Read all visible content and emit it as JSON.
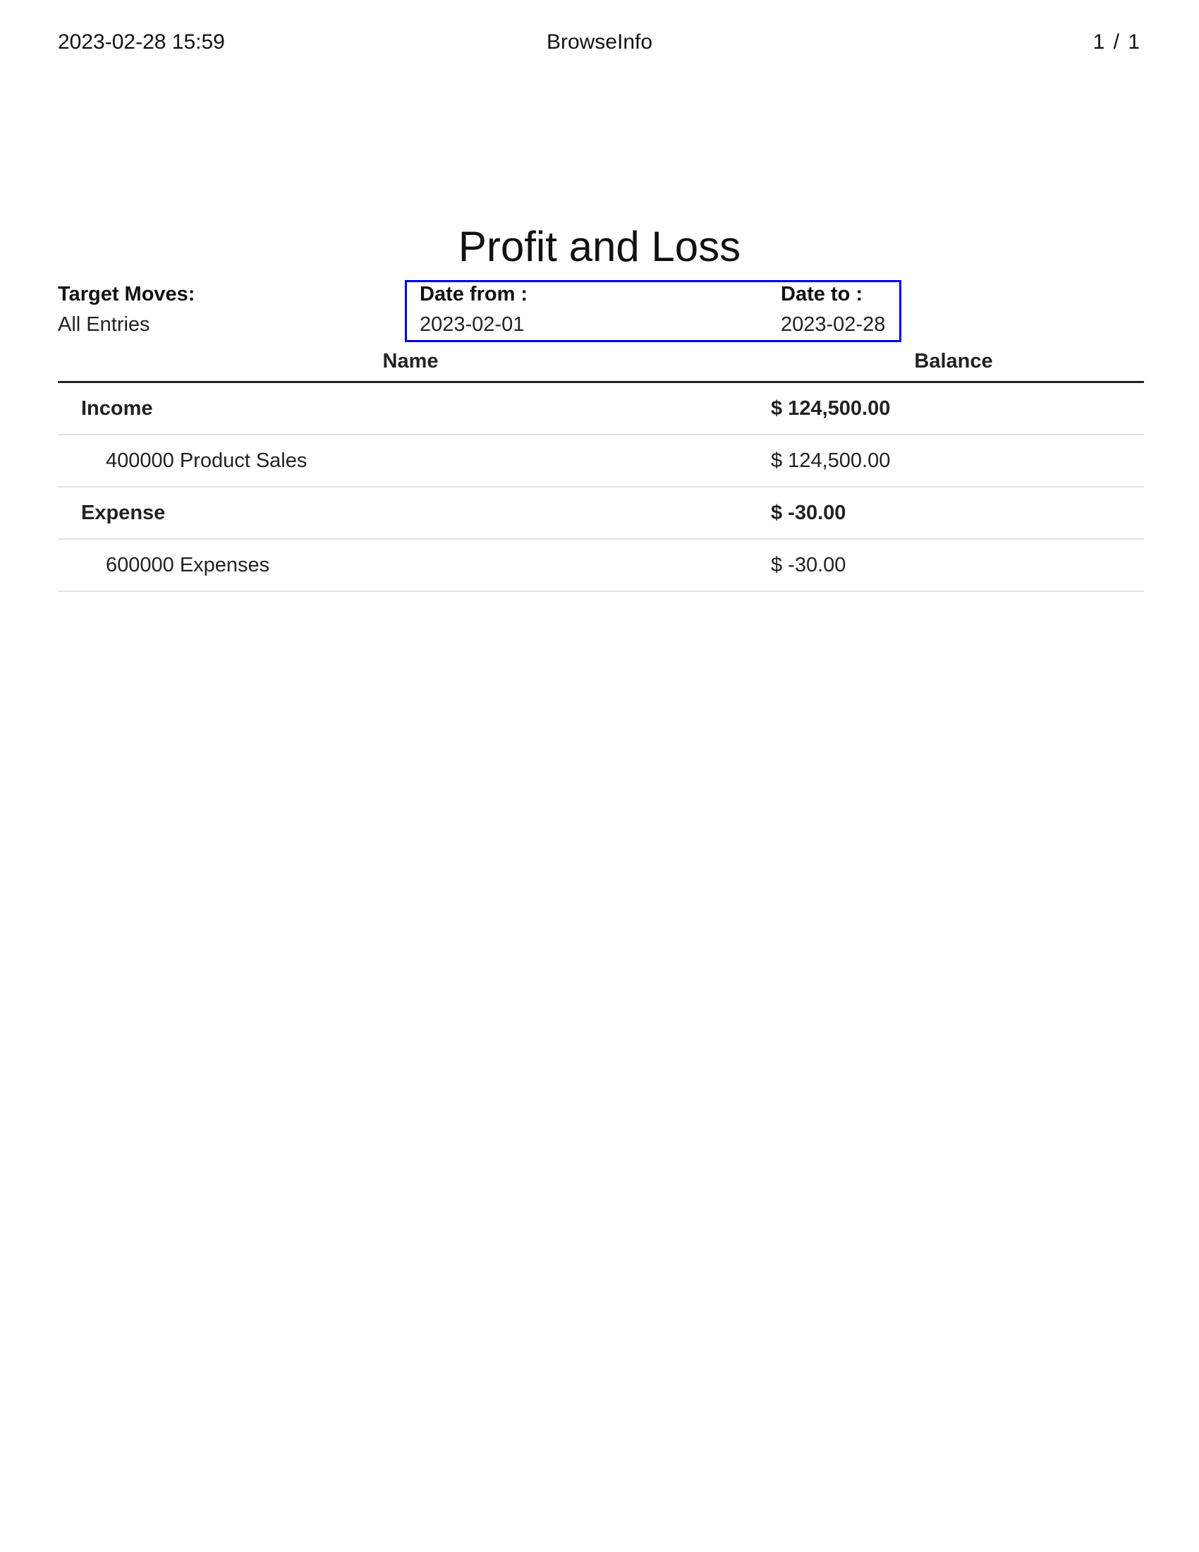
{
  "header": {
    "datetime": "2023-02-28 15:59",
    "company": "BrowseInfo",
    "page_indicator": "1  /  1"
  },
  "report": {
    "title": "Profit and Loss",
    "target_moves_label": "Target Moves:",
    "target_moves_value": "All Entries",
    "date_from_label": "Date from :",
    "date_from_value": "2023-02-01",
    "date_to_label": "Date to :",
    "date_to_value": "2023-02-28"
  },
  "table": {
    "columns": [
      "Name",
      "Balance"
    ],
    "rows": [
      {
        "name": "Income",
        "balance": "$ 124,500.00",
        "type": "group"
      },
      {
        "name": "400000 Product Sales",
        "balance": "$ 124,500.00",
        "type": "child"
      },
      {
        "name": "Expense",
        "balance": "$ -30.00",
        "type": "group"
      },
      {
        "name": "600000 Expenses",
        "balance": "$ -30.00",
        "type": "child"
      }
    ]
  },
  "colors": {
    "highlight_border": "#0000ee",
    "text": "#222222",
    "row_divider": "#e2e2e2"
  }
}
